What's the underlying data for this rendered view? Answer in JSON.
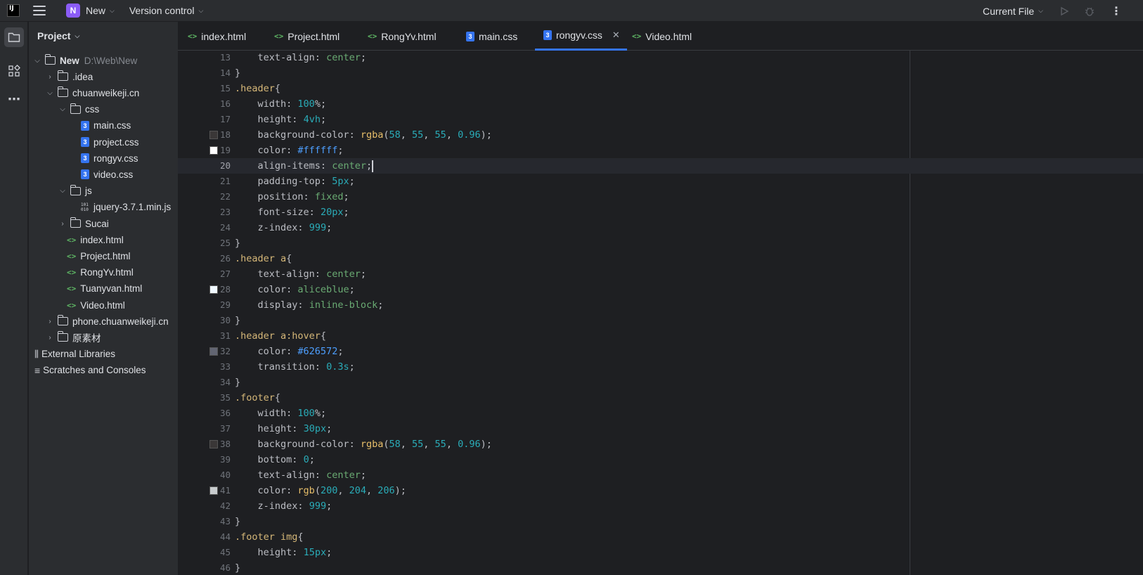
{
  "titlebar": {
    "logo_text": "IJ",
    "project_badge": "N",
    "project_name": "New",
    "vcs_label": "Version control",
    "run_config": "Current File"
  },
  "panel": {
    "title": "Project",
    "tree": [
      {
        "label": "New",
        "path": "D:\\Web\\New",
        "type": "module",
        "depth": 0,
        "arrow": "open"
      },
      {
        "label": ".idea",
        "type": "folder",
        "depth": 1,
        "arrow": "closed"
      },
      {
        "label": "chuanweikeji.cn",
        "type": "folder",
        "depth": 1,
        "arrow": "open"
      },
      {
        "label": "css",
        "type": "folder",
        "depth": 2,
        "arrow": "open"
      },
      {
        "label": "main.css",
        "type": "css",
        "depth": 3
      },
      {
        "label": "project.css",
        "type": "css",
        "depth": 3
      },
      {
        "label": "rongyv.css",
        "type": "css",
        "depth": 3
      },
      {
        "label": "video.css",
        "type": "css",
        "depth": 3
      },
      {
        "label": "js",
        "type": "folder",
        "depth": 2,
        "arrow": "open"
      },
      {
        "label": "jquery-3.7.1.min.js",
        "type": "js",
        "depth": 3
      },
      {
        "label": "Sucai",
        "type": "folder",
        "depth": 2,
        "arrow": "closed"
      },
      {
        "label": "index.html",
        "type": "html",
        "depth": 2
      },
      {
        "label": "Project.html",
        "type": "html",
        "depth": 2
      },
      {
        "label": "RongYv.html",
        "type": "html",
        "depth": 2
      },
      {
        "label": "Tuanyvan.html",
        "type": "html",
        "depth": 2
      },
      {
        "label": "Video.html",
        "type": "html",
        "depth": 2
      },
      {
        "label": "phone.chuanweikeji.cn",
        "type": "folder",
        "depth": 1,
        "arrow": "closed"
      },
      {
        "label": "原素材",
        "type": "folder",
        "depth": 1,
        "arrow": "closed"
      },
      {
        "label": "External Libraries",
        "type": "libs",
        "depth": 0
      },
      {
        "label": "Scratches and Consoles",
        "type": "scratches",
        "depth": 0
      }
    ]
  },
  "tabs": [
    {
      "label": "index.html",
      "type": "html"
    },
    {
      "label": "Project.html",
      "type": "html"
    },
    {
      "label": "RongYv.html",
      "type": "html"
    },
    {
      "label": "main.css",
      "type": "css"
    },
    {
      "label": "rongyv.css",
      "type": "css",
      "active": true
    },
    {
      "label": "Video.html",
      "type": "html"
    }
  ],
  "editor": {
    "current_line": 20,
    "lines": [
      {
        "n": "13",
        "code": [
          [
            "    ",
            "pn"
          ],
          [
            "text-align",
            "prop"
          ],
          [
            ": ",
            "pn"
          ],
          [
            "center",
            "kw"
          ],
          [
            ";",
            "pn"
          ]
        ]
      },
      {
        "n": "14",
        "code": [
          [
            "}",
            "pn"
          ]
        ]
      },
      {
        "n": "15",
        "code": [
          [
            ".header",
            "sel"
          ],
          [
            "{",
            "pn"
          ]
        ]
      },
      {
        "n": "16",
        "code": [
          [
            "    ",
            "pn"
          ],
          [
            "width",
            "prop"
          ],
          [
            ": ",
            "pn"
          ],
          [
            "100",
            "num"
          ],
          [
            "%;",
            "pn"
          ]
        ]
      },
      {
        "n": "17",
        "code": [
          [
            "    ",
            "pn"
          ],
          [
            "height",
            "prop"
          ],
          [
            ": ",
            "pn"
          ],
          [
            "4vh",
            "num"
          ],
          [
            ";",
            "pn"
          ]
        ]
      },
      {
        "n": "18",
        "swatch": "#3a3737",
        "code": [
          [
            "    ",
            "pn"
          ],
          [
            "background-color",
            "prop"
          ],
          [
            ": ",
            "pn"
          ],
          [
            "rgba",
            "fn"
          ],
          [
            "(",
            "pn"
          ],
          [
            "58",
            "num"
          ],
          [
            ", ",
            "pn"
          ],
          [
            "55",
            "num"
          ],
          [
            ", ",
            "pn"
          ],
          [
            "55",
            "num"
          ],
          [
            ", ",
            "pn"
          ],
          [
            "0.96",
            "num"
          ],
          [
            ");",
            "pn"
          ]
        ]
      },
      {
        "n": "19",
        "swatch": "#ffffff",
        "code": [
          [
            "    ",
            "pn"
          ],
          [
            "color",
            "prop"
          ],
          [
            ": ",
            "pn"
          ],
          [
            "#ffffff",
            "hex"
          ],
          [
            ";",
            "pn"
          ]
        ]
      },
      {
        "n": "20",
        "caret": true,
        "code": [
          [
            "    ",
            "pn"
          ],
          [
            "align-items",
            "prop"
          ],
          [
            ": ",
            "pn"
          ],
          [
            "center",
            "kw"
          ],
          [
            ";",
            "pn"
          ]
        ]
      },
      {
        "n": "21",
        "code": [
          [
            "    ",
            "pn"
          ],
          [
            "padding-top",
            "prop"
          ],
          [
            ": ",
            "pn"
          ],
          [
            "5px",
            "num"
          ],
          [
            ";",
            "pn"
          ]
        ]
      },
      {
        "n": "22",
        "code": [
          [
            "    ",
            "pn"
          ],
          [
            "position",
            "prop"
          ],
          [
            ": ",
            "pn"
          ],
          [
            "fixed",
            "kw"
          ],
          [
            ";",
            "pn"
          ]
        ]
      },
      {
        "n": "23",
        "code": [
          [
            "    ",
            "pn"
          ],
          [
            "font-size",
            "prop"
          ],
          [
            ": ",
            "pn"
          ],
          [
            "20px",
            "num"
          ],
          [
            ";",
            "pn"
          ]
        ]
      },
      {
        "n": "24",
        "code": [
          [
            "    ",
            "pn"
          ],
          [
            "z-index",
            "prop"
          ],
          [
            ": ",
            "pn"
          ],
          [
            "999",
            "num"
          ],
          [
            ";",
            "pn"
          ]
        ]
      },
      {
        "n": "25",
        "code": [
          [
            "}",
            "pn"
          ]
        ]
      },
      {
        "n": "26",
        "code": [
          [
            ".header a",
            "sel"
          ],
          [
            "{",
            "pn"
          ]
        ]
      },
      {
        "n": "27",
        "code": [
          [
            "    ",
            "pn"
          ],
          [
            "text-align",
            "prop"
          ],
          [
            ": ",
            "pn"
          ],
          [
            "center",
            "kw"
          ],
          [
            ";",
            "pn"
          ]
        ]
      },
      {
        "n": "28",
        "swatch": "#f0f8ff",
        "code": [
          [
            "    ",
            "pn"
          ],
          [
            "color",
            "prop"
          ],
          [
            ": ",
            "pn"
          ],
          [
            "aliceblue",
            "kw"
          ],
          [
            ";",
            "pn"
          ]
        ]
      },
      {
        "n": "29",
        "code": [
          [
            "    ",
            "pn"
          ],
          [
            "display",
            "prop"
          ],
          [
            ": ",
            "pn"
          ],
          [
            "inline-block",
            "kw"
          ],
          [
            ";",
            "pn"
          ]
        ]
      },
      {
        "n": "30",
        "code": [
          [
            "}",
            "pn"
          ]
        ]
      },
      {
        "n": "31",
        "code": [
          [
            ".header a:hover",
            "sel"
          ],
          [
            "{",
            "pn"
          ]
        ]
      },
      {
        "n": "32",
        "swatch": "#626572",
        "code": [
          [
            "    ",
            "pn"
          ],
          [
            "color",
            "prop"
          ],
          [
            ": ",
            "pn"
          ],
          [
            "#626572",
            "hex"
          ],
          [
            ";",
            "pn"
          ]
        ]
      },
      {
        "n": "33",
        "code": [
          [
            "    ",
            "pn"
          ],
          [
            "transition",
            "prop"
          ],
          [
            ": ",
            "pn"
          ],
          [
            "0.3s",
            "num"
          ],
          [
            ";",
            "pn"
          ]
        ]
      },
      {
        "n": "34",
        "code": [
          [
            "}",
            "pn"
          ]
        ]
      },
      {
        "n": "35",
        "code": [
          [
            ".footer",
            "sel"
          ],
          [
            "{",
            "pn"
          ]
        ]
      },
      {
        "n": "36",
        "code": [
          [
            "    ",
            "pn"
          ],
          [
            "width",
            "prop"
          ],
          [
            ": ",
            "pn"
          ],
          [
            "100",
            "num"
          ],
          [
            "%;",
            "pn"
          ]
        ]
      },
      {
        "n": "37",
        "code": [
          [
            "    ",
            "pn"
          ],
          [
            "height",
            "prop"
          ],
          [
            ": ",
            "pn"
          ],
          [
            "30px",
            "num"
          ],
          [
            ";",
            "pn"
          ]
        ]
      },
      {
        "n": "38",
        "swatch": "#3a3737",
        "code": [
          [
            "    ",
            "pn"
          ],
          [
            "background-color",
            "prop"
          ],
          [
            ": ",
            "pn"
          ],
          [
            "rgba",
            "fn"
          ],
          [
            "(",
            "pn"
          ],
          [
            "58",
            "num"
          ],
          [
            ", ",
            "pn"
          ],
          [
            "55",
            "num"
          ],
          [
            ", ",
            "pn"
          ],
          [
            "55",
            "num"
          ],
          [
            ", ",
            "pn"
          ],
          [
            "0.96",
            "num"
          ],
          [
            ");",
            "pn"
          ]
        ]
      },
      {
        "n": "39",
        "code": [
          [
            "    ",
            "pn"
          ],
          [
            "bottom",
            "prop"
          ],
          [
            ": ",
            "pn"
          ],
          [
            "0",
            "num"
          ],
          [
            ";",
            "pn"
          ]
        ]
      },
      {
        "n": "40",
        "code": [
          [
            "    ",
            "pn"
          ],
          [
            "text-align",
            "prop"
          ],
          [
            ": ",
            "pn"
          ],
          [
            "center",
            "kw"
          ],
          [
            ";",
            "pn"
          ]
        ]
      },
      {
        "n": "41",
        "swatch": "#c8ccce",
        "code": [
          [
            "    ",
            "pn"
          ],
          [
            "color",
            "prop"
          ],
          [
            ": ",
            "pn"
          ],
          [
            "rgb",
            "fn"
          ],
          [
            "(",
            "pn"
          ],
          [
            "200",
            "num"
          ],
          [
            ", ",
            "pn"
          ],
          [
            "204",
            "num"
          ],
          [
            ", ",
            "pn"
          ],
          [
            "206",
            "num"
          ],
          [
            ");",
            "pn"
          ]
        ]
      },
      {
        "n": "42",
        "code": [
          [
            "    ",
            "pn"
          ],
          [
            "z-index",
            "prop"
          ],
          [
            ": ",
            "pn"
          ],
          [
            "999",
            "num"
          ],
          [
            ";",
            "pn"
          ]
        ]
      },
      {
        "n": "43",
        "code": [
          [
            "}",
            "pn"
          ]
        ]
      },
      {
        "n": "44",
        "code": [
          [
            ".footer img",
            "sel"
          ],
          [
            "{",
            "pn"
          ]
        ]
      },
      {
        "n": "45",
        "code": [
          [
            "    ",
            "pn"
          ],
          [
            "height",
            "prop"
          ],
          [
            ": ",
            "pn"
          ],
          [
            "15px",
            "num"
          ],
          [
            ";",
            "pn"
          ]
        ]
      },
      {
        "n": "46",
        "code": [
          [
            "}",
            "pn"
          ]
        ]
      }
    ]
  }
}
